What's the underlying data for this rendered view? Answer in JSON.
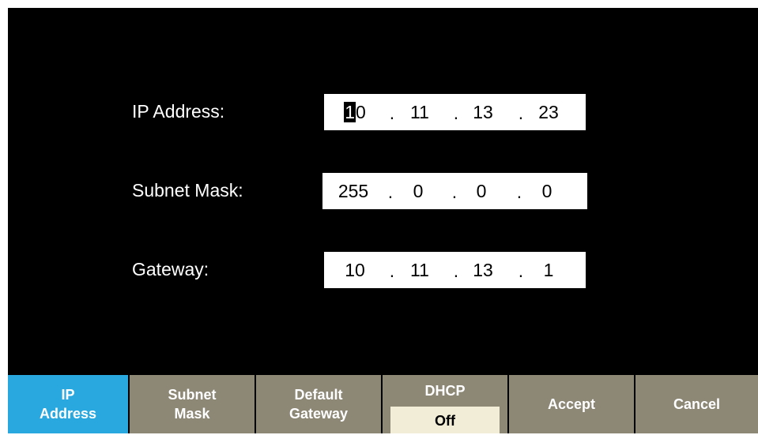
{
  "form": {
    "ip_address": {
      "label": "IP Address:",
      "octets": [
        "10",
        "11",
        "13",
        "23"
      ],
      "cursor_char": "1",
      "rest_char": "0"
    },
    "subnet_mask": {
      "label": "Subnet Mask:",
      "octets": [
        "255",
        "0",
        "0",
        "0"
      ]
    },
    "gateway": {
      "label": "Gateway:",
      "octets": [
        "10",
        "11",
        "13",
        "1"
      ]
    },
    "separator": "."
  },
  "softkeys": {
    "ip_address": {
      "line1": "IP",
      "line2": "Address"
    },
    "subnet_mask": {
      "line1": "Subnet",
      "line2": "Mask"
    },
    "default_gateway": {
      "line1": "Default",
      "line2": "Gateway"
    },
    "dhcp": {
      "title": "DHCP",
      "state": "Off"
    },
    "accept": "Accept",
    "cancel": "Cancel"
  },
  "colors": {
    "active_key": "#29a8e0",
    "inactive_key": "#8d8776",
    "dhcp_state_bg": "#f2edd6",
    "screen_bg": "#000000"
  }
}
